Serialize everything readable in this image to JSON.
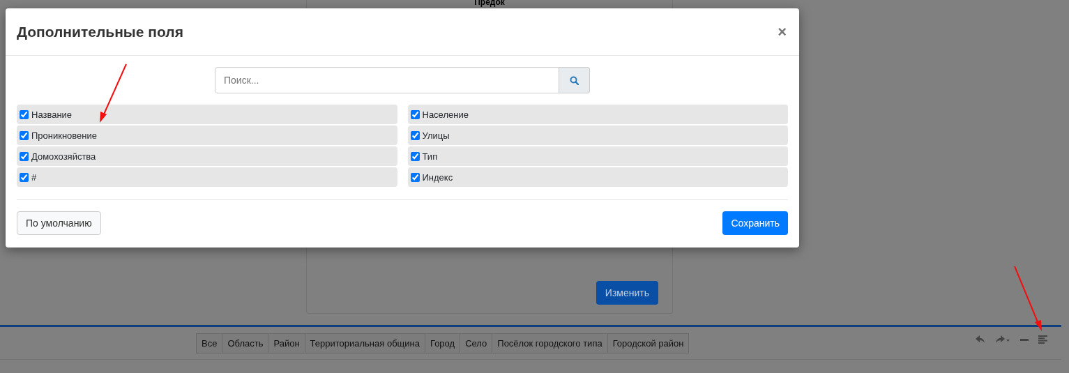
{
  "background": {
    "card": {
      "title": "Предок",
      "button": "Изменить"
    },
    "filter_tabs": [
      {
        "label": "Все",
        "selected": false
      },
      {
        "label": "Область",
        "selected": false
      },
      {
        "label": "Район",
        "selected": false
      },
      {
        "label": "Территориальная община",
        "selected": false
      },
      {
        "label": "Город",
        "selected": false
      },
      {
        "label": "Село",
        "selected": false
      },
      {
        "label": "Посёлок городского типа",
        "selected": false
      },
      {
        "label": "Городской район",
        "selected": false
      }
    ]
  },
  "modal": {
    "title": "Дополнительные поля",
    "close": "×",
    "search": {
      "placeholder": "Поиск..."
    },
    "fields": [
      {
        "label": "Название",
        "checked": true
      },
      {
        "label": "Проникновение",
        "checked": true
      },
      {
        "label": "Домохозяйства",
        "checked": true
      },
      {
        "label": "#",
        "checked": true
      },
      {
        "label": "Население",
        "checked": true
      },
      {
        "label": "Улицы",
        "checked": true
      },
      {
        "label": "Тип",
        "checked": true
      },
      {
        "label": "Индекс",
        "checked": true
      }
    ],
    "buttons": {
      "default": "По умолчанию",
      "save": "Сохранить"
    }
  }
}
